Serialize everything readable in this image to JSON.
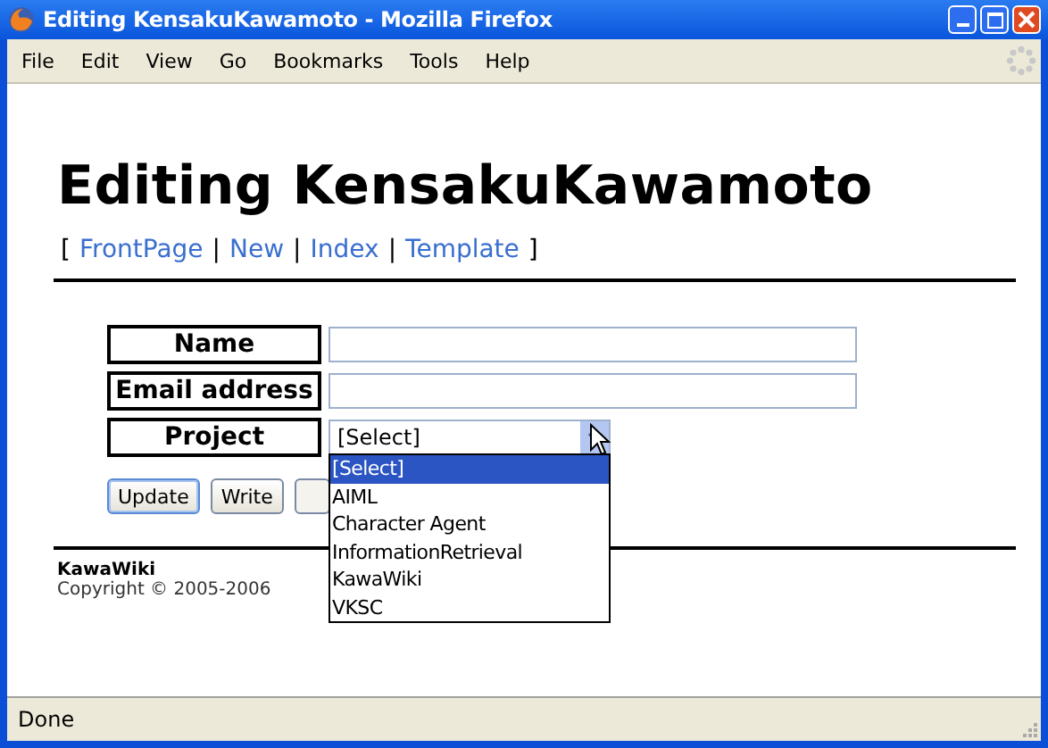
{
  "window": {
    "title": "Editing KensakuKawamoto - Mozilla Firefox"
  },
  "menu": [
    "File",
    "Edit",
    "View",
    "Go",
    "Bookmarks",
    "Tools",
    "Help"
  ],
  "page": {
    "heading": "Editing KensakuKawamoto",
    "nav": [
      {
        "label": "FrontPage"
      },
      {
        "label": "New"
      },
      {
        "label": "Index"
      },
      {
        "label": "Template"
      }
    ],
    "nav_open": "[",
    "nav_close": "]",
    "nav_sep": "|",
    "form": [
      {
        "kind": "text",
        "label": "Name"
      },
      {
        "kind": "text",
        "label": "Email address"
      },
      {
        "kind": "select",
        "label": "Project",
        "value": "[Select]",
        "expanded": true,
        "options": [
          {
            "label": "[Select]",
            "selected": true
          },
          {
            "label": "AIML",
            "selected": false
          },
          {
            "label": "Character Agent",
            "selected": false
          },
          {
            "label": "InformationRetrieval",
            "selected": false
          },
          {
            "label": "KawaWiki",
            "selected": false
          },
          {
            "label": "VKSC",
            "selected": false
          }
        ]
      }
    ],
    "buttons": [
      "Update",
      "Write"
    ],
    "footer": {
      "site": "KawaWiki",
      "copyright": "Copyright © 2005-2006"
    }
  },
  "status_bar": "Done"
}
